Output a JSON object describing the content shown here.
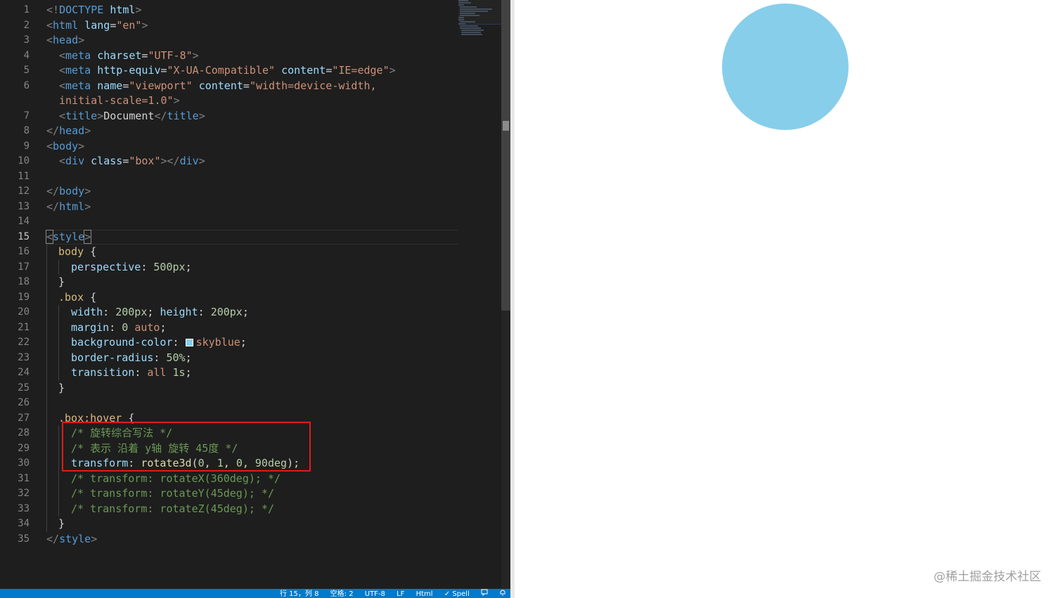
{
  "editor": {
    "line_numbers": [
      "1",
      "2",
      "3",
      "4",
      "5",
      "6",
      "",
      "7",
      "8",
      "9",
      "10",
      "11",
      "12",
      "13",
      "14",
      "15",
      "16",
      "17",
      "18",
      "19",
      "20",
      "21",
      "22",
      "23",
      "24",
      "25",
      "26",
      "27",
      "28",
      "29",
      "30",
      "31",
      "32",
      "33",
      "34",
      "35"
    ],
    "current_line": "15",
    "code": {
      "l1": {
        "a": "<!",
        "b": "DOCTYPE",
        "c": " ",
        "d": "html",
        "e": ">"
      },
      "l2": {
        "a": "<",
        "b": "html",
        "c": " ",
        "d": "lang",
        "e": "=",
        "f": "\"en\"",
        "g": ">"
      },
      "l3": {
        "a": "<",
        "b": "head",
        "c": ">"
      },
      "l4": {
        "a": "<",
        "b": "meta",
        "c": " ",
        "d": "charset",
        "e": "=",
        "f": "\"UTF-8\"",
        "g": ">"
      },
      "l5": {
        "a": "<",
        "b": "meta",
        "c": " ",
        "d": "http-equiv",
        "e": "=",
        "f": "\"X-UA-Compatible\"",
        "g": " ",
        "h": "content",
        "i": "=",
        "j": "\"IE=edge\"",
        "k": ">"
      },
      "l6": {
        "a": "<",
        "b": "meta",
        "c": " ",
        "d": "name",
        "e": "=",
        "f": "\"viewport\"",
        "g": " ",
        "h": "content",
        "i": "=",
        "j": "\"width=device-width,"
      },
      "l6b": {
        "a": "initial-scale=1.0\"",
        "b": ">"
      },
      "l7": {
        "a": "<",
        "b": "title",
        "c": ">",
        "d": "Document",
        "e": "</",
        "f": "title",
        "g": ">"
      },
      "l8": {
        "a": "</",
        "b": "head",
        "c": ">"
      },
      "l9": {
        "a": "<",
        "b": "body",
        "c": ">"
      },
      "l10": {
        "a": "<",
        "b": "div",
        "c": " ",
        "d": "class",
        "e": "=",
        "f": "\"box\"",
        "g": "></",
        "h": "div",
        "i": ">"
      },
      "l12": {
        "a": "</",
        "b": "body",
        "c": ">"
      },
      "l13": {
        "a": "</",
        "b": "html",
        "c": ">"
      },
      "l15": {
        "a": "<",
        "b": "style",
        "c": ">"
      },
      "l16": {
        "a": "body",
        "b": " {"
      },
      "l17": {
        "a": "perspective",
        "b": ": ",
        "c": "500px",
        "d": ";"
      },
      "l18": {
        "a": "}"
      },
      "l19": {
        "a": ".box",
        "b": " {"
      },
      "l20": {
        "a": "width",
        "b": ": ",
        "c": "200px",
        "d": "; ",
        "e": "height",
        "f": ": ",
        "g": "200px",
        "h": ";"
      },
      "l21": {
        "a": "margin",
        "b": ": ",
        "c": "0",
        "d": " ",
        "e": "auto",
        "f": ";"
      },
      "l22": {
        "a": "background-color",
        "b": ": ",
        "c": "skyblue",
        "d": ";"
      },
      "l23": {
        "a": "border-radius",
        "b": ": ",
        "c": "50%",
        "d": ";"
      },
      "l24": {
        "a": "transition",
        "b": ": ",
        "c": "all",
        "d": " ",
        "e": "1s",
        "f": ";"
      },
      "l25": {
        "a": "}"
      },
      "l27": {
        "a": ".box:hover",
        "b": " {"
      },
      "l28": {
        "a": "/* 旋转综合写法 */"
      },
      "l29": {
        "a": "/* 表示 沿着 y轴 旋转 45度 */"
      },
      "l30": {
        "a": "transform",
        "b": ": ",
        "c": "rotate3d",
        "d": "(",
        "e": "0",
        "f": ", ",
        "g": "1",
        "h": ", ",
        "i": "0",
        "j": ", ",
        "k": "90deg",
        "l": ");"
      },
      "l31": {
        "a": "/* transform: rotateX(360deg); */"
      },
      "l32": {
        "a": "/* transform: rotateY(45deg); */"
      },
      "l33": {
        "a": "/* transform: rotateZ(45deg); */"
      },
      "l34": {
        "a": "}"
      },
      "l35": {
        "a": "</",
        "b": "style",
        "c": ">"
      }
    }
  },
  "statusbar": {
    "position": "行 15，列 8",
    "indent": "空格: 2",
    "encoding": "UTF-8",
    "eol": "LF",
    "language": "Html",
    "spell": "✓ Spell"
  },
  "preview": {
    "box_color": "#87ceeb"
  },
  "watermark": "@稀土掘金技术社区",
  "colors": {
    "editor_bg": "#1e1e1e",
    "status_bg": "#007acc",
    "annotation_border": "#e01b1b"
  }
}
